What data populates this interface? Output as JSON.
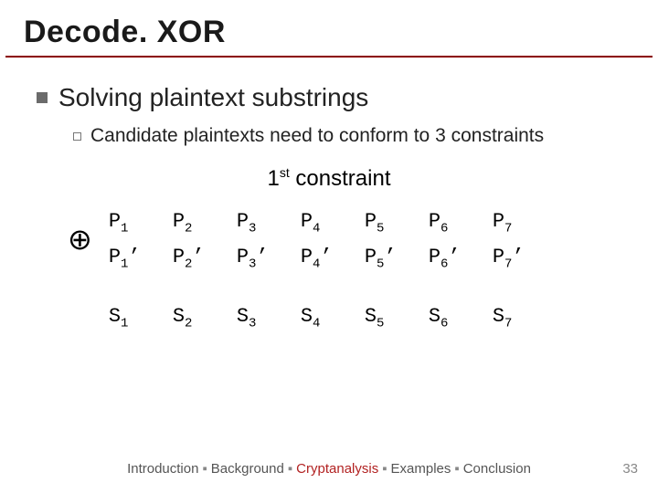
{
  "title": "Decode. XOR",
  "bullet_main": "Solving plaintext substrings",
  "bullet_sub": "Candidate plaintexts need to conform to 3 constraints",
  "constraint_label_pre": "1",
  "constraint_label_sup": "st",
  "constraint_label_post": " constraint",
  "xor_symbol": "⊕",
  "rows": {
    "p": [
      "P",
      "P",
      "P",
      "P",
      "P",
      "P",
      "P"
    ],
    "p_sub": [
      "1",
      "2",
      "3",
      "4",
      "5",
      "6",
      "7"
    ],
    "pp": [
      "P",
      "P",
      "P",
      "P",
      "P",
      "P",
      "P"
    ],
    "pp_sub": [
      "1",
      "2",
      "3",
      "4",
      "5",
      "6",
      "7"
    ],
    "pp_suffix": "’",
    "s": [
      "S",
      "S",
      "S",
      "S",
      "S",
      "S",
      "S"
    ],
    "s_sub": [
      "1",
      "2",
      "3",
      "4",
      "5",
      "6",
      "7"
    ]
  },
  "footer": {
    "items": [
      "Introduction",
      "Background",
      "Cryptanalysis",
      "Examples",
      "Conclusion"
    ],
    "highlight_index": 2,
    "separator": "▪"
  },
  "page_number": "33"
}
